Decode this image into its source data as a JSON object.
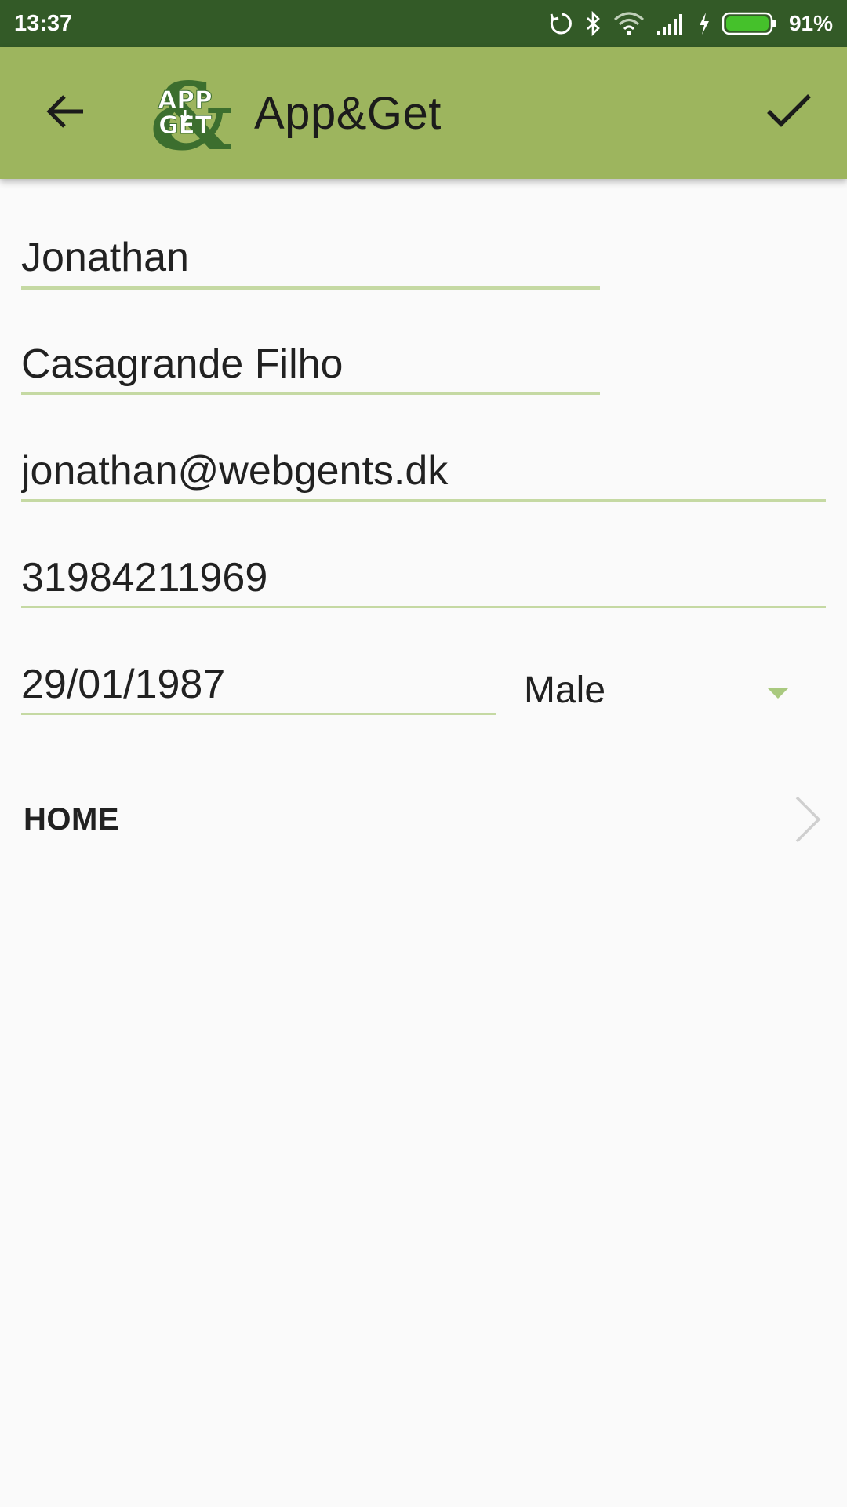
{
  "status_bar": {
    "time": "13:37",
    "battery_percent": "91%",
    "icons": [
      "sync-icon",
      "bluetooth-icon",
      "wifi-icon",
      "signal-icon",
      "charging-icon",
      "battery-icon"
    ]
  },
  "app_bar": {
    "title": "App&Get",
    "logo_text_top": "APP",
    "logo_text_bottom": "GET",
    "back_icon": "arrow-back-icon",
    "confirm_icon": "checkmark-icon"
  },
  "form": {
    "first_name": "Jonathan",
    "last_name": "Casagrande Filho",
    "email": "jonathan@webgents.dk",
    "phone": "31984211969",
    "birthdate": "29/01/1987",
    "gender": "Male"
  },
  "home_row": {
    "label": "HOME"
  },
  "colors": {
    "status_bar": "#335a27",
    "app_bar": "#9db55e",
    "field_underline": "#c5d9a3",
    "background": "#fafafa",
    "logo_green": "#3c6e2e"
  }
}
